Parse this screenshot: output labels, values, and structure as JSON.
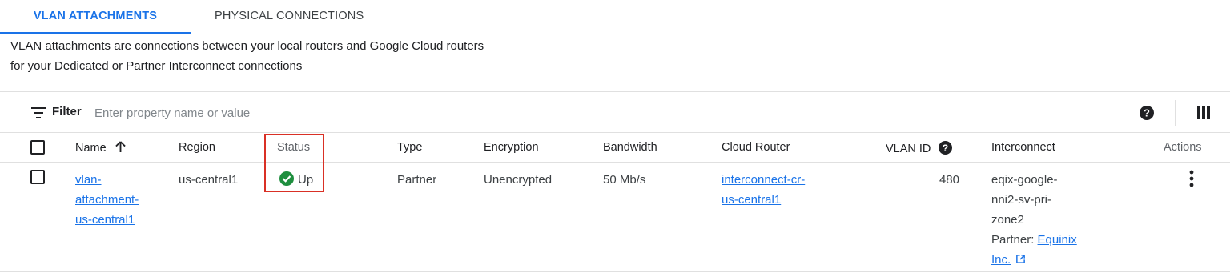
{
  "tabs": [
    {
      "label": "VLAN ATTACHMENTS",
      "active": true
    },
    {
      "label": "PHYSICAL CONNECTIONS",
      "active": false
    }
  ],
  "description": {
    "line1": "VLAN attachments are connections between your local routers and Google Cloud routers",
    "line2": "for your Dedicated or Partner Interconnect connections"
  },
  "filter": {
    "label": "Filter",
    "placeholder": "Enter property name or value",
    "icon": "filter-icon"
  },
  "toolbar_icons": [
    "help-icon",
    "column-display-icon"
  ],
  "table": {
    "columns": {
      "name": "Name",
      "region": "Region",
      "status": "Status",
      "type": "Type",
      "encryption": "Encryption",
      "bandwidth": "Bandwidth",
      "cloud_router": "Cloud Router",
      "vlan_id": "VLAN ID",
      "interconnect": "Interconnect",
      "actions": "Actions"
    },
    "sort": {
      "column": "Name",
      "direction": "ascending"
    },
    "rows": [
      {
        "name": "vlan-attachment-us-central1",
        "name_lines": [
          "vlan-",
          "attachment-",
          "us-central1"
        ],
        "region": "us-central1",
        "status": "Up",
        "type": "Partner",
        "encryption": "Unencrypted",
        "bandwidth": "50 Mb/s",
        "cloud_router": "interconnect-cr-us-central1",
        "cloud_router_lines": [
          "interconnect-cr-",
          "us-central1"
        ],
        "vlan_id": "480",
        "interconnect_lines": [
          "eqix-google-",
          "nni2-sv-pri-",
          "zone2"
        ],
        "partner_label": "Partner: ",
        "partner_link_lines": [
          "Equinix",
          "Inc."
        ]
      }
    ]
  },
  "colors": {
    "accent": "#1a73e8",
    "status_ok": "#1e8e3e",
    "highlight_box": "#d93025"
  }
}
